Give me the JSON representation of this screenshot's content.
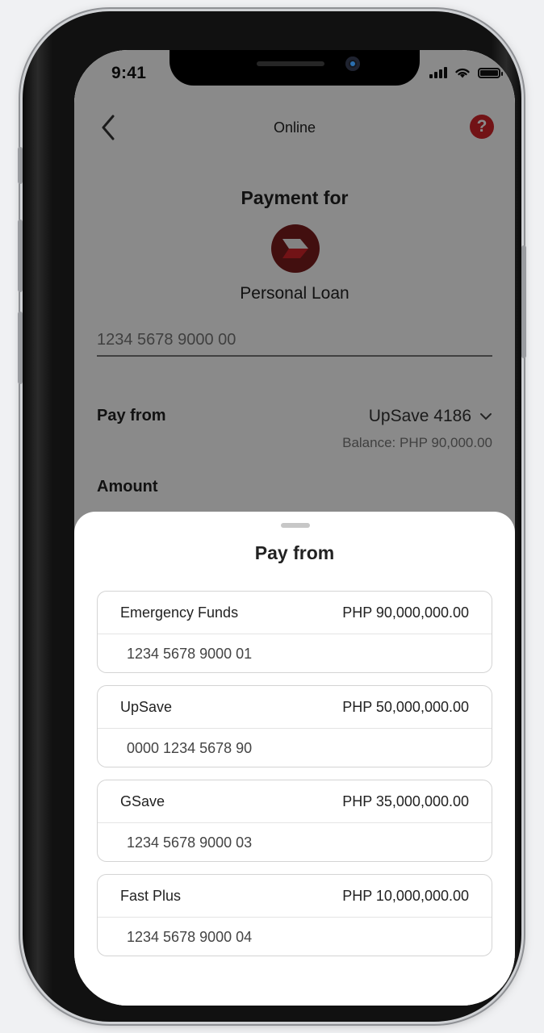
{
  "status_bar": {
    "time": "9:41"
  },
  "header": {
    "title": "Online",
    "help": "?"
  },
  "payment": {
    "heading": "Payment for",
    "biller_name": "Personal Loan",
    "account_number": "1234 5678 9000 00",
    "pay_from_label": "Pay from",
    "pay_from_value": "UpSave 4186",
    "balance": "Balance: PHP 90,000.00",
    "amount_label": "Amount"
  },
  "sheet": {
    "title": "Pay from",
    "accounts": [
      {
        "name": "Emergency Funds",
        "balance": "PHP 90,000,000.00",
        "number": "1234 5678 9000 01"
      },
      {
        "name": "UpSave",
        "balance": "PHP 50,000,000.00",
        "number": "0000 1234 5678 90"
      },
      {
        "name": "GSave",
        "balance": "PHP 35,000,000.00",
        "number": "1234 5678 9000 03"
      },
      {
        "name": "Fast Plus",
        "balance": "PHP 10,000,000.00",
        "number": "1234 5678 9000 04"
      }
    ]
  },
  "colors": {
    "brand_red": "#d2232a",
    "logo_dark_red": "#7a1c1d",
    "overlay": "rgba(0,0,0,0.46)"
  },
  "icons": [
    "chevron-left-icon",
    "help-icon",
    "chevron-down-icon",
    "signal-icon",
    "wifi-icon",
    "battery-icon",
    "biller-logo"
  ]
}
